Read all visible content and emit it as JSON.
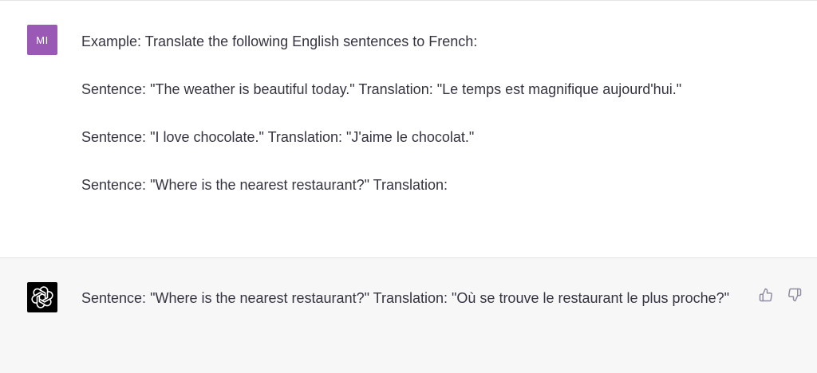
{
  "user_message": {
    "avatar_initials": "MI",
    "avatar_color": "#9b59b6",
    "paragraphs": [
      "Example: Translate the following English sentences to French:",
      "Sentence: \"The weather is beautiful today.\" Translation: \"Le temps est magnifique aujourd'hui.\"",
      "Sentence: \"I love chocolate.\" Translation: \"J'aime le chocolat.\"",
      "Sentence: \"Where is the nearest restaurant?\" Translation:"
    ]
  },
  "assistant_message": {
    "avatar_icon": "openai-logo-icon",
    "avatar_color": "#000000",
    "text": "Sentence: \"Where is the nearest restaurant?\" Translation: \"Où se trouve le restaurant le plus proche?\"",
    "feedback": {
      "thumbs_up_icon": "thumbs-up-icon",
      "thumbs_down_icon": "thumbs-down-icon"
    }
  }
}
